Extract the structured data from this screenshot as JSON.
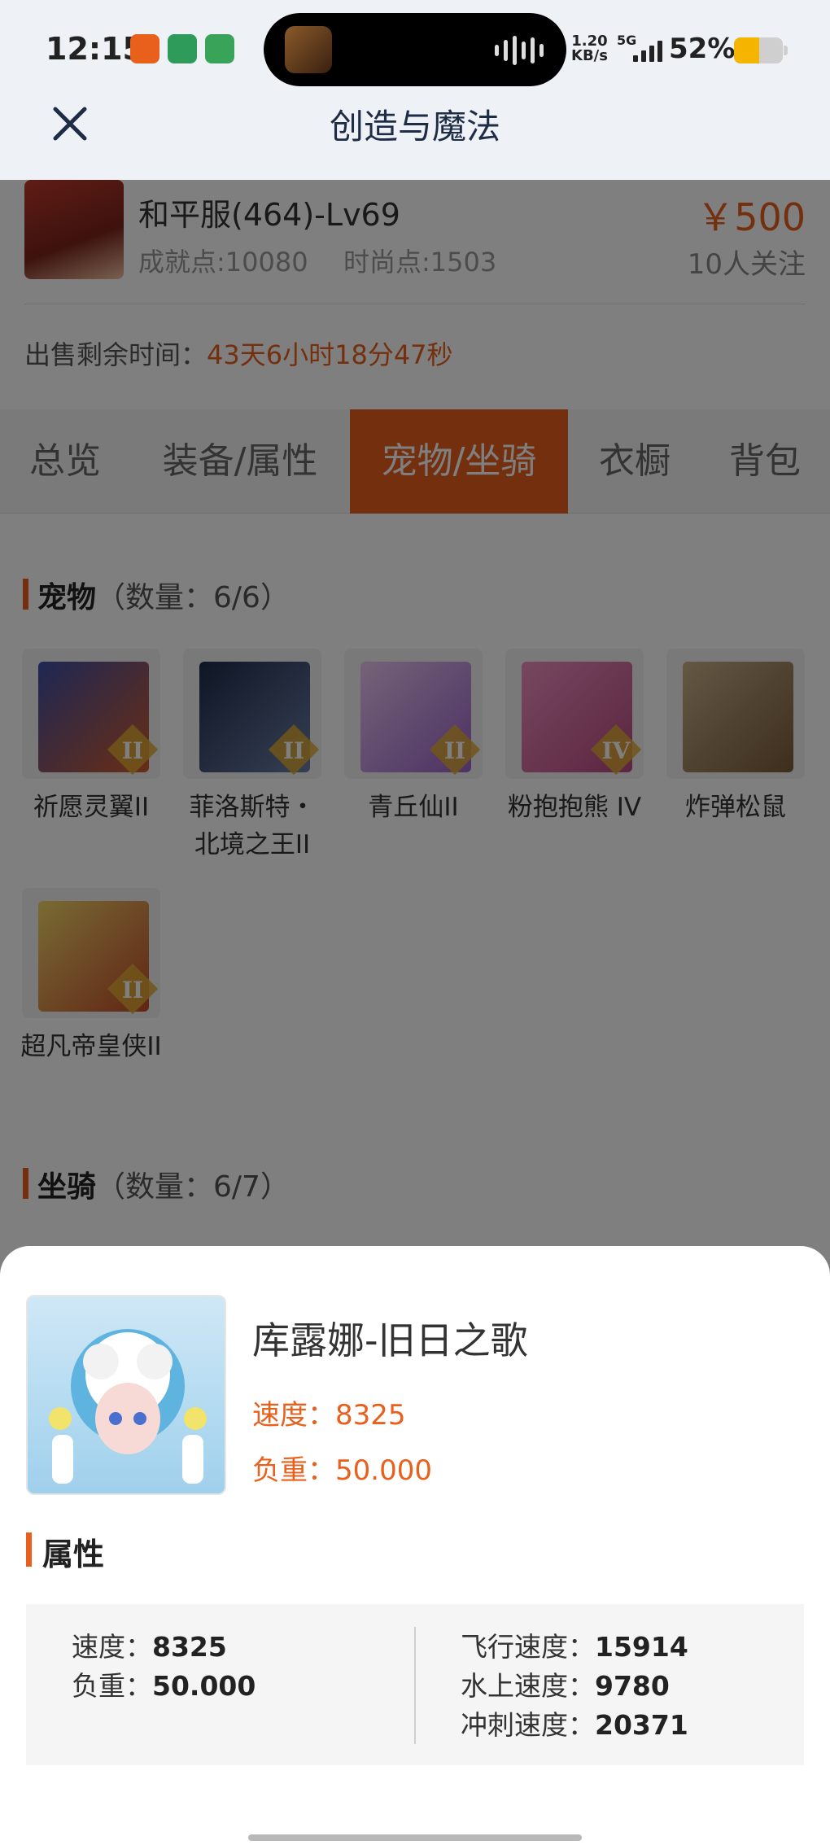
{
  "status_bar": {
    "time": "12:15",
    "net_speed_value": "1.20",
    "net_speed_unit": "KB/s",
    "network": "5G",
    "battery": "52%",
    "battery_level": 0.52,
    "battery_color": "#f4b400"
  },
  "header": {
    "title": "创造与魔法",
    "close_icon": "close-icon"
  },
  "listing": {
    "character": "和平服(464)-Lv69",
    "achievement": "成就点:10080",
    "fashion": "时尚点:1503",
    "price": "￥500",
    "followers": "10人关注",
    "sale_label": "出售剩余时间：",
    "sale_remaining": "43天6小时18分47秒",
    "accent_color": "#e8601c"
  },
  "tabs": [
    {
      "label": "总览",
      "active": false
    },
    {
      "label": "装备/属性",
      "active": false
    },
    {
      "label": "宠物/坐骑",
      "active": true
    },
    {
      "label": "衣橱",
      "active": false
    },
    {
      "label": "背包",
      "active": false
    }
  ],
  "pets_section": {
    "title": "宠物",
    "count": "（数量：6/6）",
    "pets": [
      {
        "name": "祈愿灵翼II",
        "tier": "II"
      },
      {
        "name": "菲洛斯特・北境之王II",
        "tier": "II"
      },
      {
        "name": "青丘仙II",
        "tier": "II"
      },
      {
        "name": "粉抱抱熊 IV",
        "tier": "IV"
      },
      {
        "name": "炸弹松鼠",
        "tier": ""
      },
      {
        "name": "超凡帝皇侠II",
        "tier": "II"
      }
    ]
  },
  "mounts_section": {
    "title": "坐骑",
    "count": "（数量：6/7）"
  },
  "mount_detail": {
    "name": "库露娜-旧日之歌",
    "speed": "速度：8325",
    "load": "负重：50.000",
    "attributes_title": "属性",
    "attributes_left": [
      {
        "label": "速度：",
        "value": "8325"
      },
      {
        "label": "负重：",
        "value": "50.000"
      }
    ],
    "attributes_right": [
      {
        "label": "飞行速度：",
        "value": "15914"
      },
      {
        "label": "水上速度：",
        "value": "9780"
      },
      {
        "label": "冲刺速度：",
        "value": "20371"
      }
    ]
  }
}
